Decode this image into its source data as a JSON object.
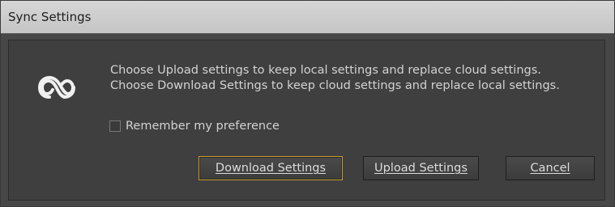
{
  "window": {
    "title": "Sync Settings"
  },
  "dialog": {
    "icon": "creative-cloud-icon",
    "message_line1": "Choose Upload settings to keep local settings and replace cloud settings.",
    "message_line2": "Choose Download Settings to keep cloud settings and replace local settings.",
    "remember_label": "Remember my preference",
    "remember_checked": false
  },
  "buttons": {
    "download": "Download Settings",
    "upload": "Upload Settings",
    "cancel": "Cancel"
  },
  "colors": {
    "dialog_bg": "#3f3f3f",
    "title_bar": "#c5c5c5",
    "default_button_border": "#c89a2a",
    "text": "#d2d2d2"
  }
}
